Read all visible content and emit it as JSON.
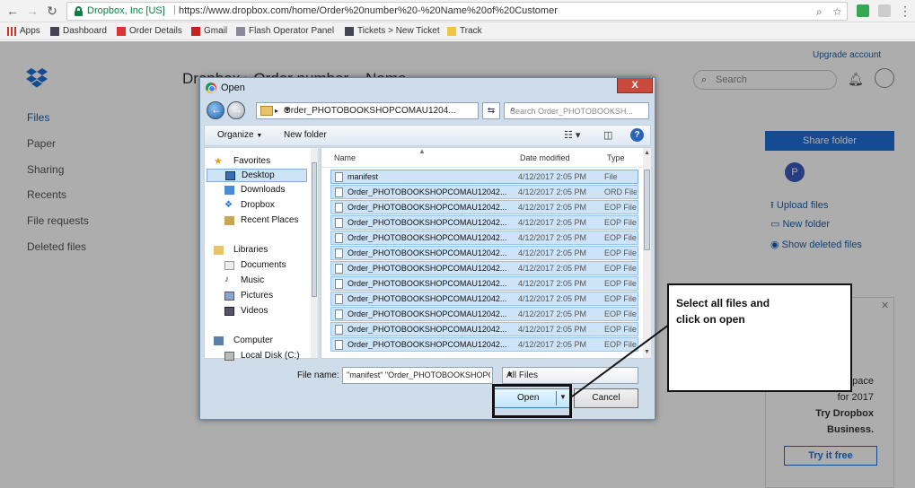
{
  "browser": {
    "site_name": "Dropbox, Inc [US]",
    "url": "https://www.dropbox.com/home/Order%20number%20-%20Name%20of%20Customer",
    "bookmarks": [
      {
        "label": "Apps"
      },
      {
        "label": "Dashboard"
      },
      {
        "label": "Order Details"
      },
      {
        "label": "Gmail"
      },
      {
        "label": "Flash Operator Panel"
      },
      {
        "label": "Tickets > New Ticket"
      },
      {
        "label": "Track"
      }
    ]
  },
  "page": {
    "upgrade_link": "Upgrade account",
    "title": "Dropbox › Order number – Name",
    "search_placeholder": "Search",
    "sidebar": [
      "Files",
      "Paper",
      "Sharing",
      "Recents",
      "File requests",
      "Deleted files"
    ],
    "share_button": "Share folder",
    "avatar_initial": "P",
    "actions": [
      "Upload files",
      "New folder",
      "Show deleted files"
    ],
    "promo_lines": [
      "...pace",
      "for 2017",
      "Try Dropbox",
      "Business."
    ],
    "promo_button": "Try it free"
  },
  "dialog": {
    "title": "Open",
    "close_label": "X",
    "path": "Order_PHOTOBOOKSHOPCOMAU1204...",
    "search_placeholder": "Search Order_PHOTOBOOKSH...",
    "organize_label": "Organize",
    "new_folder_label": "New folder",
    "nav": {
      "favorites_header": "Favorites",
      "favorites": [
        "Desktop",
        "Downloads",
        "Dropbox",
        "Recent Places"
      ],
      "libraries_header": "Libraries",
      "libraries": [
        "Documents",
        "Music",
        "Pictures",
        "Videos"
      ],
      "computer_header": "Computer",
      "computer": [
        "Local Disk (C:)"
      ]
    },
    "columns": {
      "name": "Name",
      "date": "Date modified",
      "type": "Type"
    },
    "files": [
      {
        "name": "manifest",
        "date": "4/12/2017 2:05 PM",
        "type": "File"
      },
      {
        "name": "Order_PHOTOBOOKSHOPCOMAU12042...",
        "date": "4/12/2017 2:05 PM",
        "type": "ORD File"
      },
      {
        "name": "Order_PHOTOBOOKSHOPCOMAU12042...",
        "date": "4/12/2017 2:05 PM",
        "type": "EOP File"
      },
      {
        "name": "Order_PHOTOBOOKSHOPCOMAU12042...",
        "date": "4/12/2017 2:05 PM",
        "type": "EOP File"
      },
      {
        "name": "Order_PHOTOBOOKSHOPCOMAU12042...",
        "date": "4/12/2017 2:05 PM",
        "type": "EOP File"
      },
      {
        "name": "Order_PHOTOBOOKSHOPCOMAU12042...",
        "date": "4/12/2017 2:05 PM",
        "type": "EOP File"
      },
      {
        "name": "Order_PHOTOBOOKSHOPCOMAU12042...",
        "date": "4/12/2017 2:05 PM",
        "type": "EOP File"
      },
      {
        "name": "Order_PHOTOBOOKSHOPCOMAU12042...",
        "date": "4/12/2017 2:05 PM",
        "type": "EOP File"
      },
      {
        "name": "Order_PHOTOBOOKSHOPCOMAU12042...",
        "date": "4/12/2017 2:05 PM",
        "type": "EOP File"
      },
      {
        "name": "Order_PHOTOBOOKSHOPCOMAU12042...",
        "date": "4/12/2017 2:05 PM",
        "type": "EOP File"
      },
      {
        "name": "Order_PHOTOBOOKSHOPCOMAU12042...",
        "date": "4/12/2017 2:05 PM",
        "type": "EOP File"
      },
      {
        "name": "Order_PHOTOBOOKSHOPCOMAU12042...",
        "date": "4/12/2017 2:05 PM",
        "type": "EOP File"
      }
    ],
    "file_name_label": "File name:",
    "file_name_value": "\"manifest\" \"Order_PHOTOBOOKSHOPC",
    "filter_value": "All Files",
    "open_label": "Open",
    "cancel_label": "Cancel"
  },
  "callout": {
    "line1": "Select all files and",
    "line2": "click on open"
  },
  "colors": {
    "dropbox_blue": "#1e6fd9",
    "annotation": "#111111"
  }
}
